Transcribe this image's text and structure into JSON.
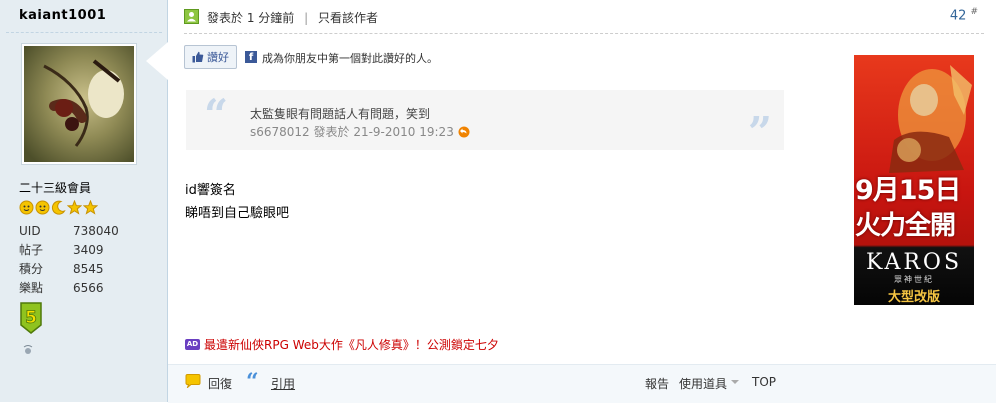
{
  "author": {
    "name": "kaiant1001",
    "rank": "二十三級會員",
    "stats": [
      {
        "label": "UID",
        "value": "738040"
      },
      {
        "label": "帖子",
        "value": "3409"
      },
      {
        "label": "積分",
        "value": "8545"
      },
      {
        "label": "樂點",
        "value": "6566"
      }
    ]
  },
  "post": {
    "posted_label": "發表於",
    "posted_time": "1 分鐘前",
    "only_author": "只看該作者",
    "floor": "42",
    "floor_mark": "#"
  },
  "like": {
    "button_label": "讚好",
    "facebook_text": "成為你朋友中第一個對此讚好的人。"
  },
  "quote": {
    "text": "太監隻眼有問題話人有問題，笑到",
    "meta": "s6678012 發表於 21-9-2010 19:23"
  },
  "message": {
    "lines": [
      "id響簽名",
      "睇唔到自己驗眼吧"
    ]
  },
  "banner": {
    "date": "9月15日",
    "slogan": "火力全開",
    "brand": "KAROS",
    "subtitle": "眾神世紀",
    "tag": "大型改版"
  },
  "text_ad": {
    "badge": "AD",
    "text": "最遣新仙俠RPG Web大作《凡人修真》！公測鎖定七夕"
  },
  "actions": {
    "reply": "回復",
    "quote": "引用",
    "report": "報告",
    "tools": "使用道具",
    "top": "TOP"
  },
  "colors": {
    "sidebar_bg": "#e5edf2",
    "link_blue": "#369",
    "ad_red": "#cc0000",
    "facebook_blue": "#3b5998"
  }
}
